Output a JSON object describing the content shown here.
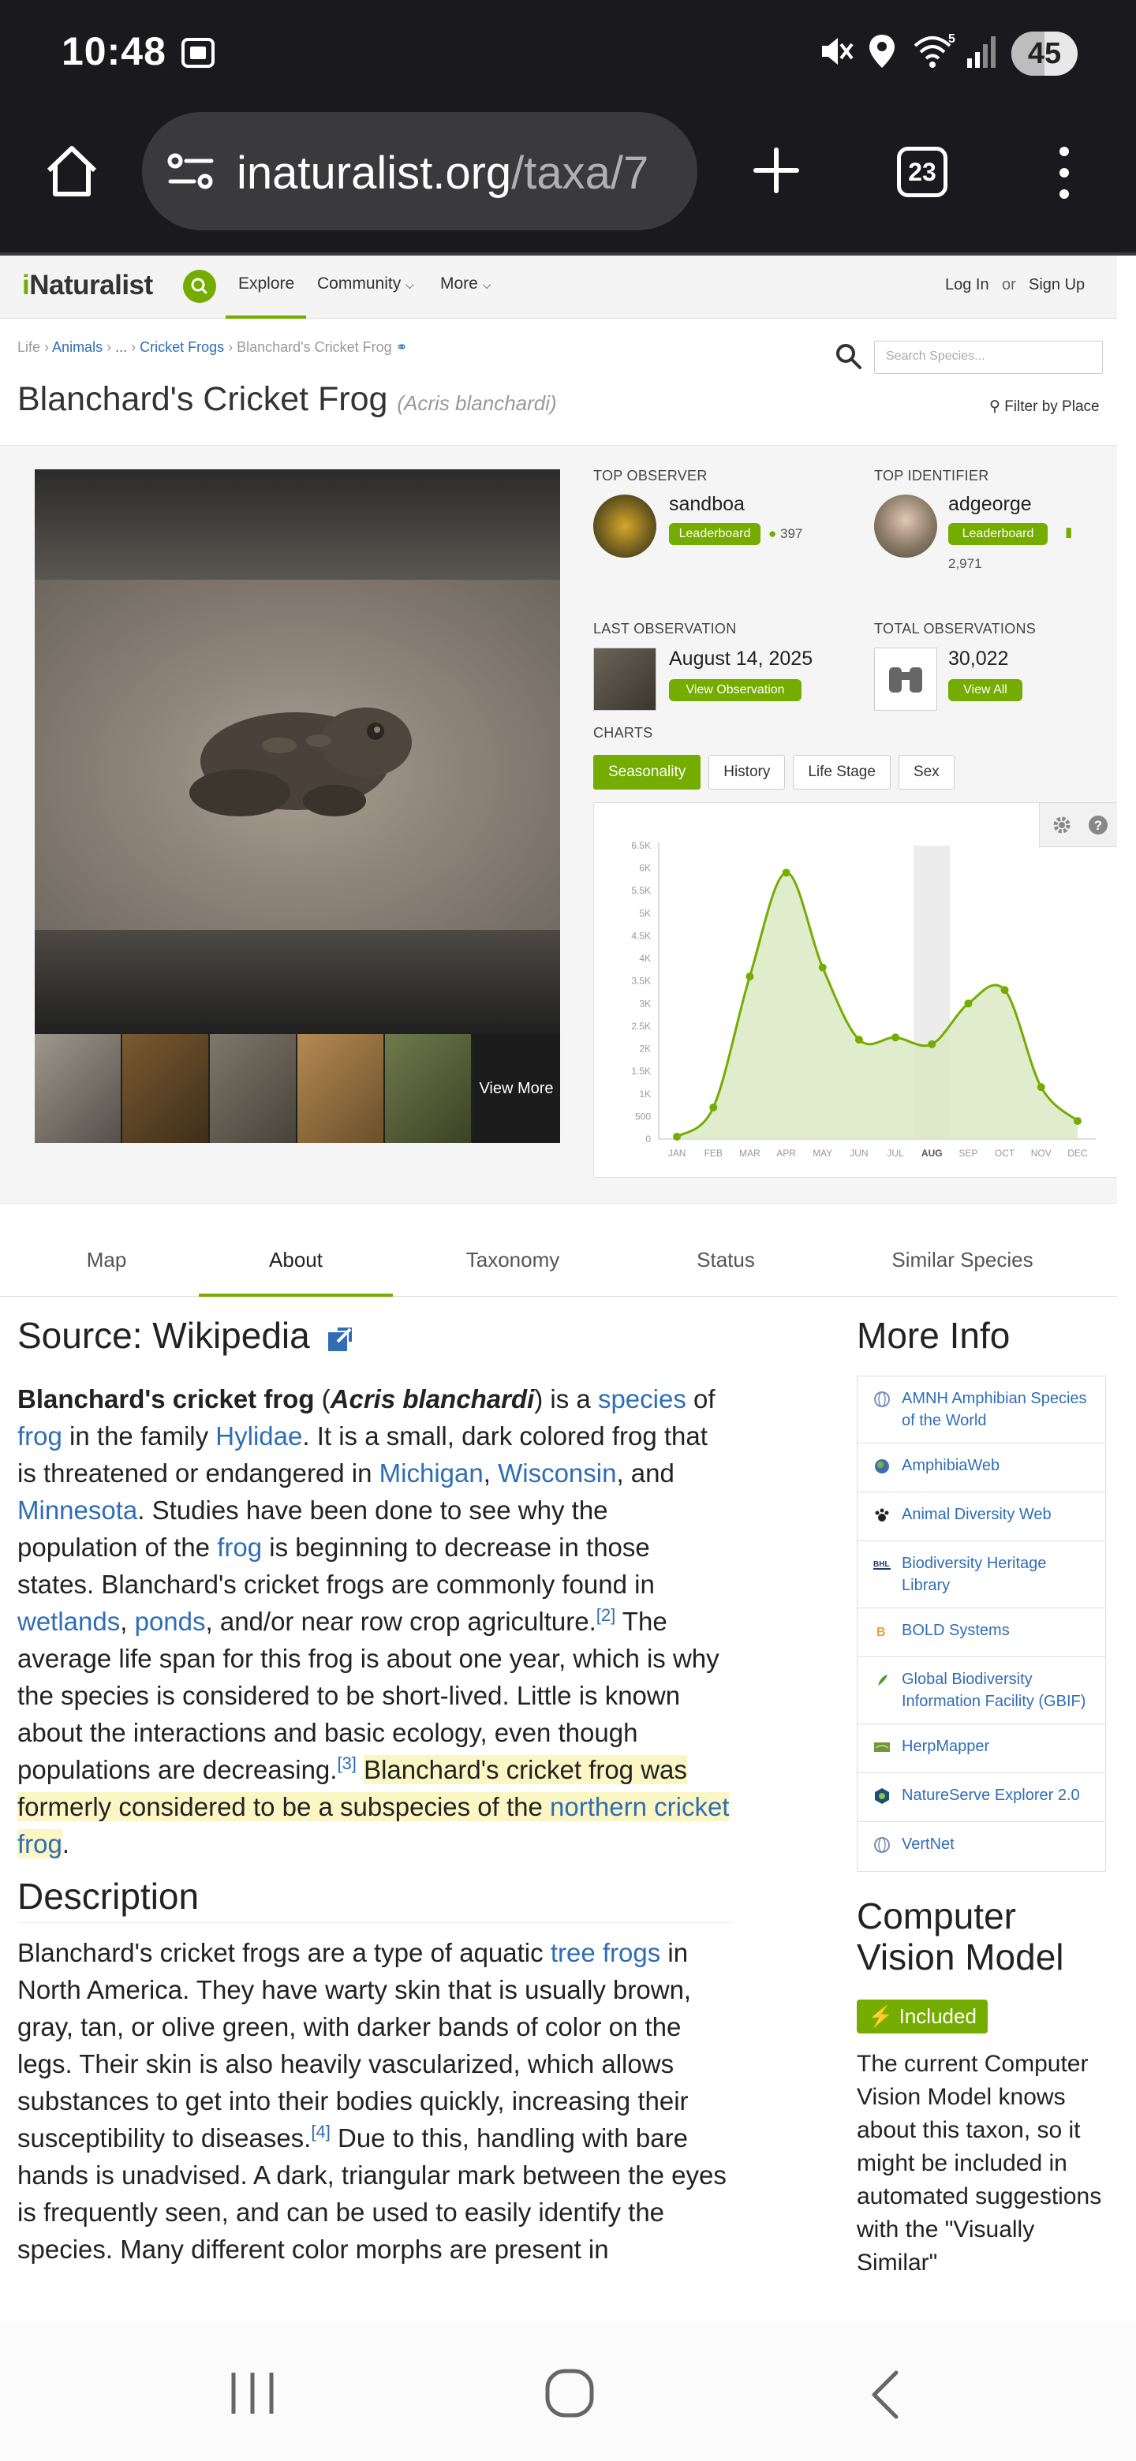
{
  "status_bar": {
    "time": "10:48",
    "battery": "45",
    "wifi_badge": "5"
  },
  "browser": {
    "url_host": "inaturalist.org",
    "url_path": "/taxa/7",
    "tab_count": "23"
  },
  "site": {
    "logo": "iNaturalist",
    "nav": [
      "Explore",
      "Community",
      "More"
    ],
    "login": "Log In",
    "or": "or",
    "signup": "Sign Up"
  },
  "breadcrumb": {
    "life": "Life",
    "animals": "Animals",
    "ellipsis": "...",
    "cricket_frogs": "Cricket Frogs",
    "current": "Blanchard's Cricket Frog"
  },
  "search_placeholder": "Search Species...",
  "title": {
    "common": "Blanchard's Cricket Frog",
    "scientific": "(Acris blanchardi)"
  },
  "filter_place": "Filter by Place",
  "photos": {
    "view_more": "View More"
  },
  "top_observer": {
    "label": "TOP OBSERVER",
    "name": "sandboa",
    "button": "Leaderboard",
    "count": "397"
  },
  "top_identifier": {
    "label": "TOP IDENTIFIER",
    "name": "adgeorge",
    "button": "Leaderboard",
    "count": "2,971"
  },
  "last_observation": {
    "label": "LAST OBSERVATION",
    "date": "August 14, 2025",
    "button": "View Observation"
  },
  "total_observations": {
    "label": "TOTAL OBSERVATIONS",
    "count": "30,022",
    "button": "View All"
  },
  "charts": {
    "label": "CHARTS",
    "tabs": [
      "Seasonality",
      "History",
      "Life Stage",
      "Sex"
    ]
  },
  "chart_data": {
    "type": "area",
    "categories": [
      "JAN",
      "FEB",
      "MAR",
      "APR",
      "MAY",
      "JUN",
      "JUL",
      "AUG",
      "SEP",
      "OCT",
      "NOV",
      "DEC"
    ],
    "series": [
      {
        "values": [
          50,
          700,
          3600,
          5900,
          3800,
          2200,
          2250,
          2100,
          3000,
          3300,
          1150,
          400
        ]
      }
    ],
    "highlight": "AUG",
    "yticks": [
      "0",
      "500",
      "1K",
      "1.5K",
      "2K",
      "2.5K",
      "3K",
      "3.5K",
      "4K",
      "4.5K",
      "5K",
      "5.5K",
      "6K",
      "6.5K"
    ],
    "ylim": [
      0,
      6500
    ],
    "colors": {
      "line": "#74ac00",
      "fill": "#dbeac3"
    }
  },
  "tabs": [
    "Map",
    "About",
    "Taxonomy",
    "Status",
    "Similar Species"
  ],
  "about": {
    "source_heading": "Source: Wikipedia",
    "description_heading": "Description"
  },
  "more_info": {
    "title": "More Info",
    "items": [
      "AMNH Amphibian Species of the World",
      "AmphibiaWeb",
      "Animal Diversity Web",
      "Biodiversity Heritage Library",
      "BOLD Systems",
      "Global Biodiversity Information Facility (GBIF)",
      "HerpMapper",
      "NatureServe Explorer 2.0",
      "VertNet"
    ]
  },
  "cv": {
    "title": "Computer Vision Model",
    "badge": "Included",
    "text": "The current Computer Vision Model knows about this taxon, so it might be included in automated suggestions with the \"Visually Similar\""
  }
}
